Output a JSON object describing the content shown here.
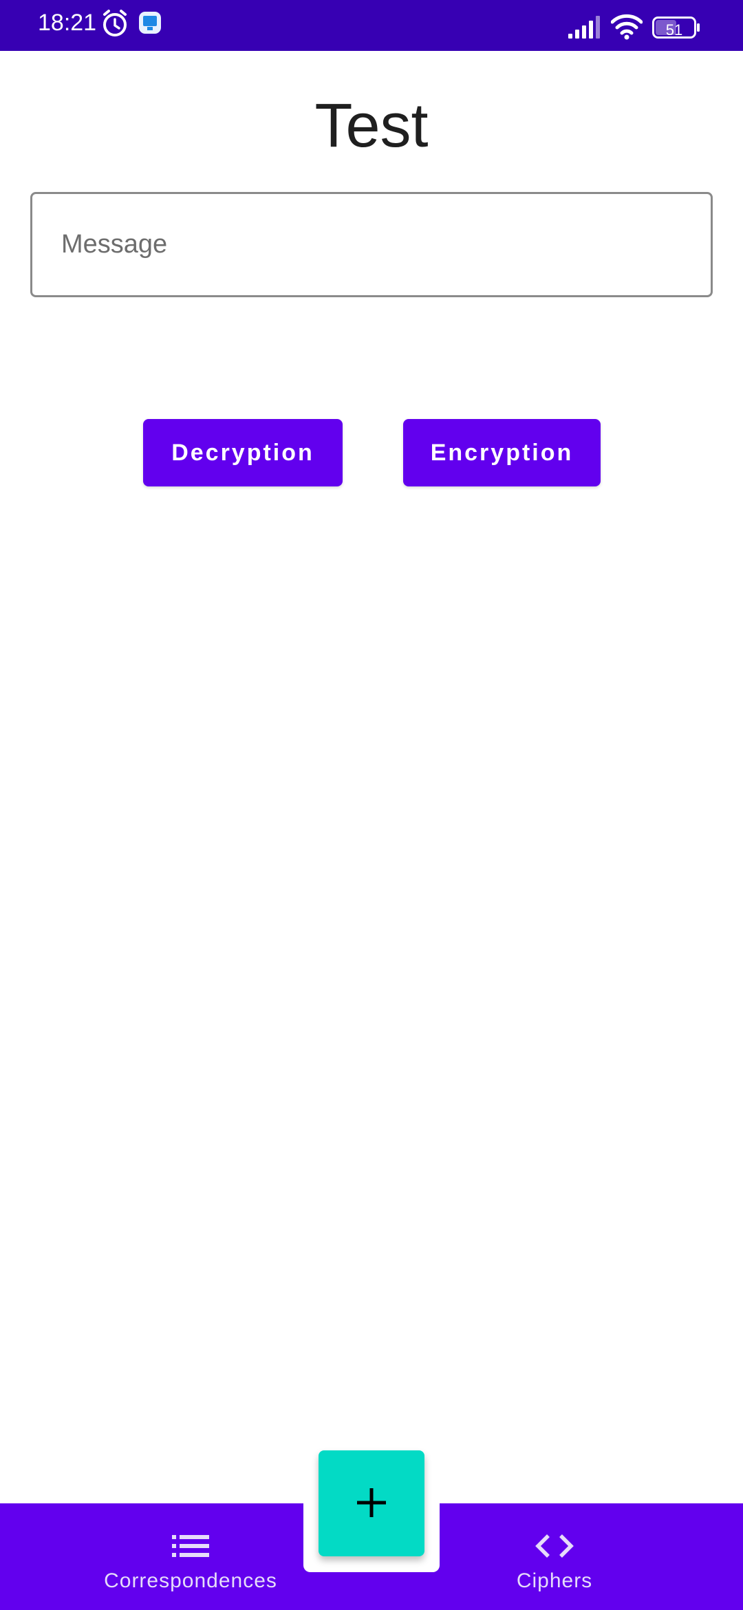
{
  "status_bar": {
    "time": "18:21",
    "battery": "51",
    "icons": [
      "alarm-icon",
      "app-notification-icon",
      "signal-icon",
      "wifi-icon",
      "battery-icon"
    ]
  },
  "page": {
    "title": "Test"
  },
  "message_input": {
    "placeholder": "Message",
    "value": ""
  },
  "actions": {
    "decryption_label": "Decryption",
    "encryption_label": "Encryption"
  },
  "bottom_nav": {
    "items": [
      {
        "label": "Correspondences",
        "icon": "list-icon"
      },
      {
        "label": "Ciphers",
        "icon": "code-icon"
      }
    ],
    "fab_icon": "plus-icon"
  },
  "colors": {
    "status_bar": "#3700b3",
    "primary": "#6200ee",
    "fab": "#03dac5",
    "background": "#ffffff"
  }
}
